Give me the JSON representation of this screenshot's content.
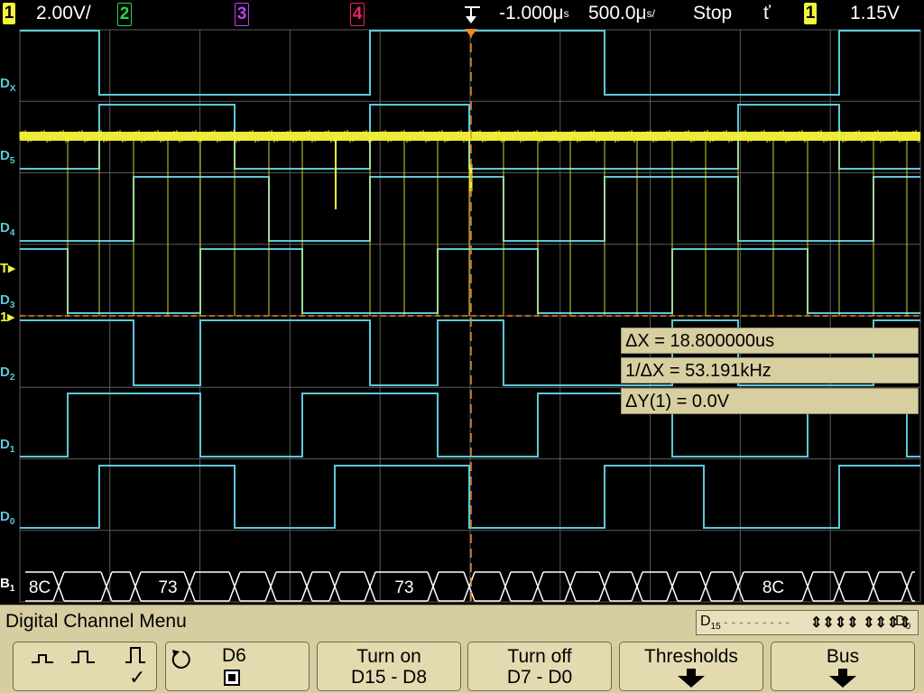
{
  "top": {
    "ch1_num": "1",
    "ch1_scale": "2.00V/",
    "ch2_num": "2",
    "ch3_num": "3",
    "ch4_num": "4",
    "time_delay": "-1.000μ",
    "time_delay_suffix": "s",
    "time_scale": "500.0μ",
    "time_scale_suffix": "s/",
    "run_state": "Stop",
    "trigger_slope_glyph": "ť",
    "trig_source": "1",
    "trig_level": "1.15V"
  },
  "colors": {
    "ch1": "#f4f43a",
    "ch2": "#22d84a",
    "ch3": "#c340f0",
    "ch4": "#f0206c",
    "digital": "#5cc8d8",
    "cursor": "#f08a1e",
    "grid": "#5a5a5a"
  },
  "channel_labels": {
    "dx": {
      "main": "D",
      "sub": "X"
    },
    "d5": {
      "main": "D",
      "sub": "5"
    },
    "d4": {
      "main": "D",
      "sub": "4"
    },
    "t": "T",
    "d3": {
      "main": "D",
      "sub": "3"
    },
    "ch1_marker": "1",
    "d2": {
      "main": "D",
      "sub": "2"
    },
    "d1": {
      "main": "D",
      "sub": "1"
    },
    "d0": {
      "main": "D",
      "sub": "0"
    },
    "b1": {
      "main": "B",
      "sub": "1"
    }
  },
  "bus_values": [
    "8C",
    "73",
    "73",
    "8C"
  ],
  "measurements": [
    "ΔX = 18.800000us",
    "1/ΔX = 53.191kHz",
    "ΔY(1) = 0.0V"
  ],
  "menu": {
    "title": "Digital Channel Menu",
    "strip_hi": "D",
    "strip_hi_sub": "15",
    "strip_dashes": "- - - - - - - - -",
    "strip_arrows": "⇕⇕⇕⇕ ⇕⇕⇕⇕",
    "strip_lo": "D",
    "strip_lo_sub": "0"
  },
  "softkeys": {
    "threshold_check": "✓",
    "channel_label": "D6",
    "turn_on_line1": "Turn on",
    "turn_on_line2": "D15 - D8",
    "turn_off_line1": "Turn off",
    "turn_off_line2": "D7 - D0",
    "thresholds": "Thresholds",
    "bus": "Bus"
  }
}
